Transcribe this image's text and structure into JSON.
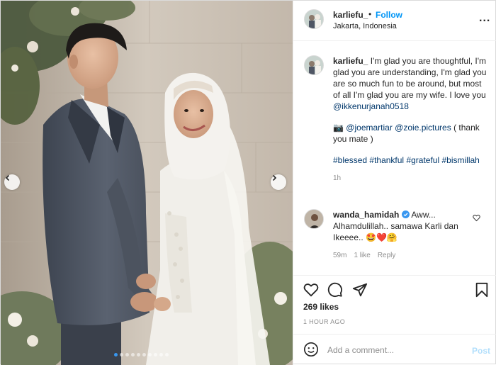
{
  "post": {
    "author": "karliefu_",
    "follow_label": "Follow",
    "bullet": "•",
    "location": "Jakarta, Indonesia",
    "more_label": "..."
  },
  "caption": {
    "username": "karliefu_",
    "text": "I'm glad you are thoughtful, I'm glad you are understanding, I'm glad you are so much fun to be around, but most of all I'm glad you are my wife. I love you",
    "mention": "@ikkenurjanah0518",
    "credit_prefix": "📷",
    "credit_mention_1": "@joemartiar",
    "credit_mention_2": "@zoie.pictures",
    "credit_suffix": "( thank you mate )",
    "hashtags": [
      "#blessed",
      "#thankful",
      "#grateful",
      "#bismillah"
    ],
    "age": "1h"
  },
  "reply": {
    "username": "wanda_hamidah",
    "verified": true,
    "text": "Aww... Alhamdulillah.. samawa Karli dan Ikeeee..",
    "emojis": "🤩❤️🤗",
    "age": "59m",
    "likes": "1 like",
    "reply_label": "Reply"
  },
  "stats": {
    "likes": "269 likes",
    "timestamp": "1 HOUR AGO"
  },
  "composer": {
    "placeholder": "Add a comment...",
    "post_label": "Post"
  },
  "carousel": {
    "total": 10,
    "active": 0
  },
  "colors": {
    "accent": "#0095f6",
    "link": "#00376b",
    "muted": "#8e8e8e",
    "post_disabled": "#b2dffc",
    "verified": "#3897f0",
    "heart_red": "#e0245e"
  },
  "icons": {
    "like": "heart-icon",
    "comment": "comment-bubble-icon",
    "share": "paper-plane-icon",
    "save": "bookmark-icon",
    "emoji": "smiley-icon",
    "prev": "chevron-left-icon",
    "next": "chevron-right-icon",
    "verified": "verified-badge-icon"
  }
}
